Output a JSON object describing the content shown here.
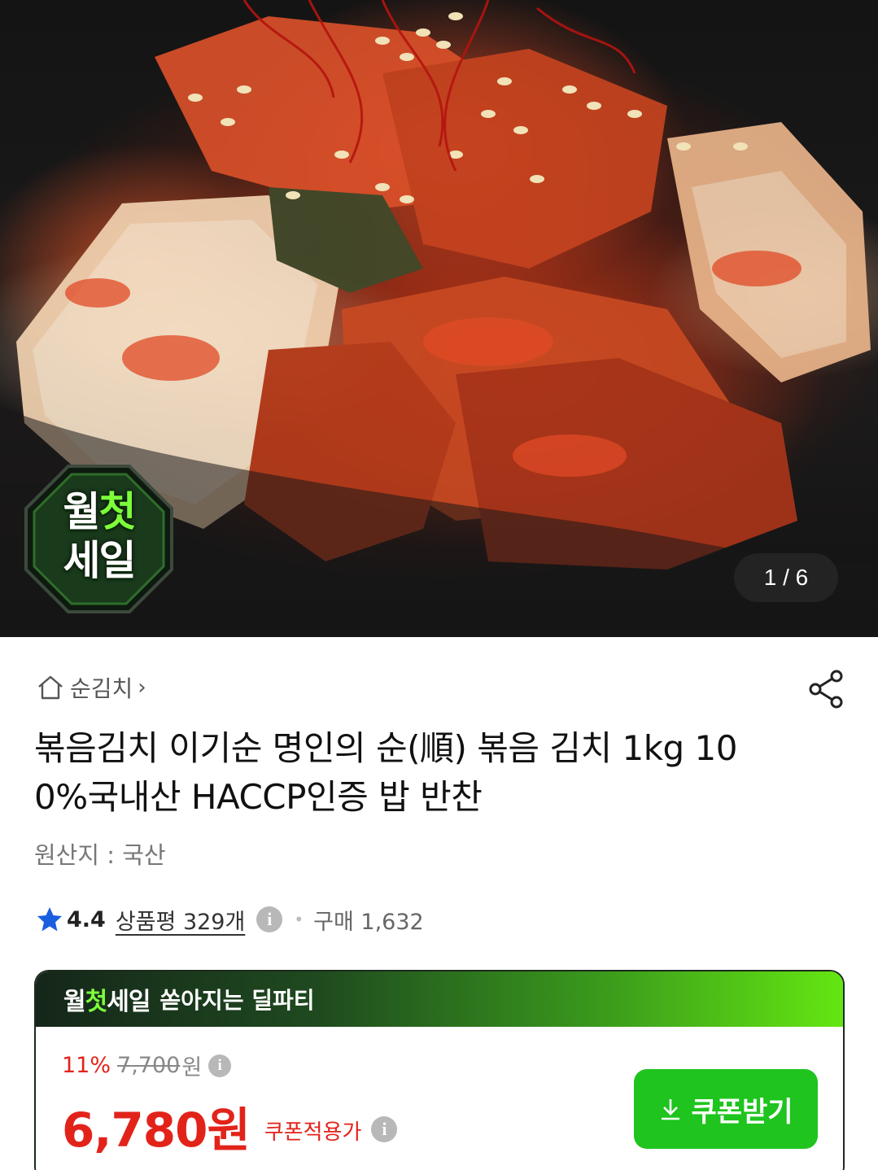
{
  "hero": {
    "badge": {
      "line1_a": "월",
      "line1_b": "첫",
      "line2": "세일"
    },
    "counter": "1 / 6"
  },
  "breadcrumb": {
    "category": "순김치"
  },
  "product": {
    "title": "볶음김치 이기순 명인의 순(順) 볶음 김치 1kg 100%국내산 HACCP인증 밥 반찬",
    "origin": "원산지 : 국산",
    "rating": "4.4",
    "reviews": "상품평 329개",
    "purchases": "구매 1,632"
  },
  "deal": {
    "brand_a": "월",
    "brand_b": "첫",
    "brand_c": "세일",
    "headline": "쏟아지는 딜파티",
    "discount_pct": "11%",
    "original_price": "7,700",
    "original_unit": "원",
    "price": "6,780원",
    "coupon_label": "쿠폰적용가",
    "coupon_button": "쿠폰받기"
  },
  "colors": {
    "accent_red": "#e2231a",
    "accent_green": "#1fc41f",
    "star_blue": "#1a5fe0"
  }
}
